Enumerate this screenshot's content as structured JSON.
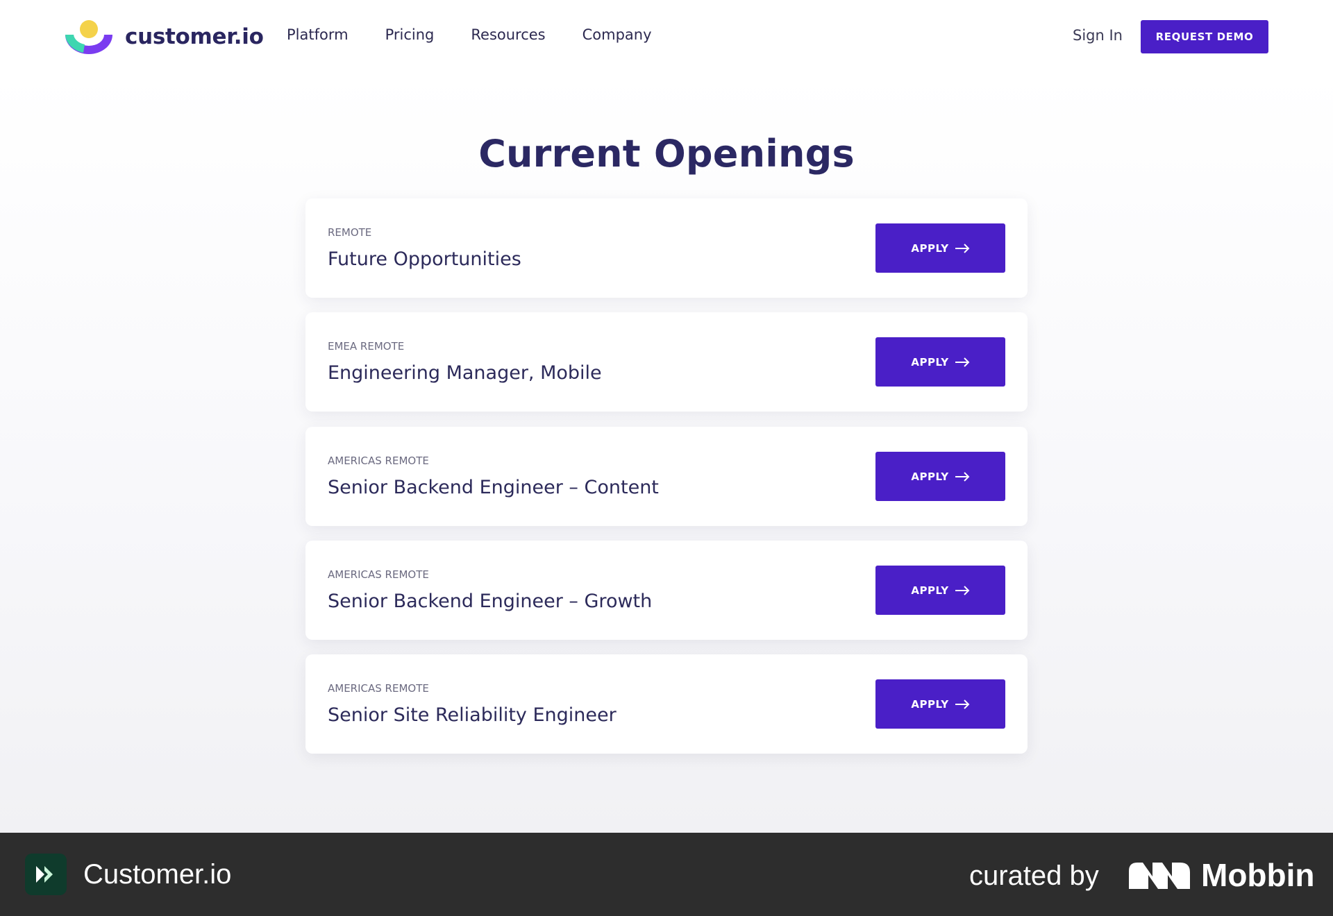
{
  "header": {
    "logo_text": "customer.io",
    "nav": [
      "Platform",
      "Pricing",
      "Resources",
      "Company"
    ],
    "sign_in": "Sign In",
    "request_demo": "REQUEST DEMO"
  },
  "main": {
    "title": "Current Openings",
    "jobs": [
      {
        "location": "REMOTE",
        "title": "Future Opportunities",
        "apply": "APPLY"
      },
      {
        "location": "EMEA REMOTE",
        "title": "Engineering Manager, Mobile",
        "apply": "APPLY"
      },
      {
        "location": "AMERICAS REMOTE",
        "title": "Senior Backend Engineer – Content",
        "apply": "APPLY"
      },
      {
        "location": "AMERICAS REMOTE",
        "title": "Senior Backend Engineer – Growth",
        "apply": "APPLY"
      },
      {
        "location": "AMERICAS REMOTE",
        "title": "Senior Site Reliability Engineer",
        "apply": "APPLY"
      }
    ]
  },
  "footer": {
    "app_name": "Customer.io",
    "curated_by": "curated by",
    "mobbin": "Mobbin"
  },
  "colors": {
    "accent": "#4a1fc7",
    "heading": "#2b2863",
    "footer_bg": "#2d2d2d"
  },
  "icons": [
    "customerio-logo-icon",
    "arrow-right-icon",
    "customerio-app-icon",
    "mobbin-logo-icon"
  ]
}
